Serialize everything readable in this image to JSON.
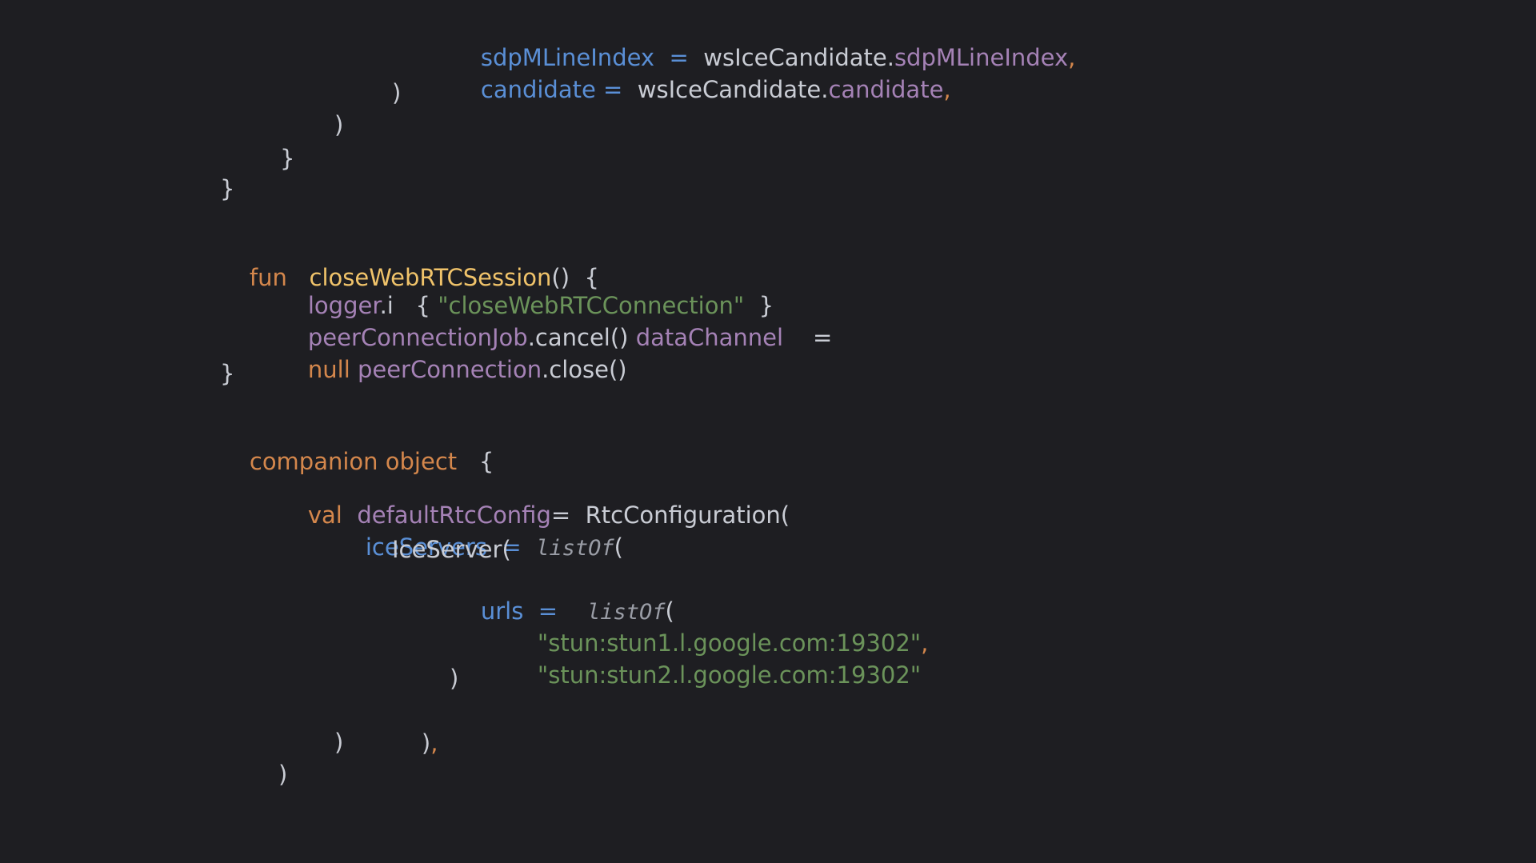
{
  "code": {
    "l1_name": "sdpMLineIndex",
    "l1_eq": "=",
    "l1_obj": "wsIceCandidate.",
    "l1_prop": "sdpMLineIndex",
    "l1_comma": ",",
    "l2_name": "candidate",
    "l2_eq": "=",
    "l2_obj": "wsIceCandidate.",
    "l2_prop": "candidate",
    "l2_comma": ",",
    "l3": ")",
    "l4": ")",
    "l5": "}",
    "l6": "}",
    "l7_kw": "fun",
    "l7_fn": "closeWebRTCSession",
    "l7_parens": "()",
    "l7_brace": "{",
    "l8_obj": "logger",
    "l8_method": ".i",
    "l8_open": "{",
    "l8_str": "\"closeWebRTCConnection\"",
    "l8_close": "}",
    "l9_obj": "peerConnectionJob",
    "l9_call": ".cancel()",
    "l9_prop": "dataChannel",
    "l9_eq": "=",
    "l10_kw": "null",
    "l10_obj": "peerConnection",
    "l10_call": ".close()",
    "l11": "}",
    "l12_kw1": "companion",
    "l12_kw2": "object",
    "l12_brace": "{",
    "l13_kw": "val",
    "l13_prop": "defaultRtcConfig",
    "l13_eq": "=",
    "l13_cls": "RtcConfiguration(",
    "l14_name": "iceServers",
    "l14_eq": "=",
    "l14_fn": "listOf",
    "l14_paren": "(",
    "l15": "IceServer(",
    "l16_name": "urls",
    "l16_eq": "=",
    "l16_fn": "listOf",
    "l16_paren": "(",
    "l17_str": "\"stun:stun1.l.google.com:19302\"",
    "l17_comma": ",",
    "l18_str": "\"stun:stun2.l.google.com:19302\"",
    "l19": ")",
    "l20_paren": ")",
    "l20_comma": ",",
    "l21": ")",
    "l22": ")"
  },
  "colors": {
    "background": "#1e1e22",
    "keyword": "#d4874c",
    "function": "#f0c36a",
    "property": "#a582b6",
    "parameter": "#5a8fd6",
    "string": "#6b935a",
    "plain": "#c9ccd4"
  }
}
